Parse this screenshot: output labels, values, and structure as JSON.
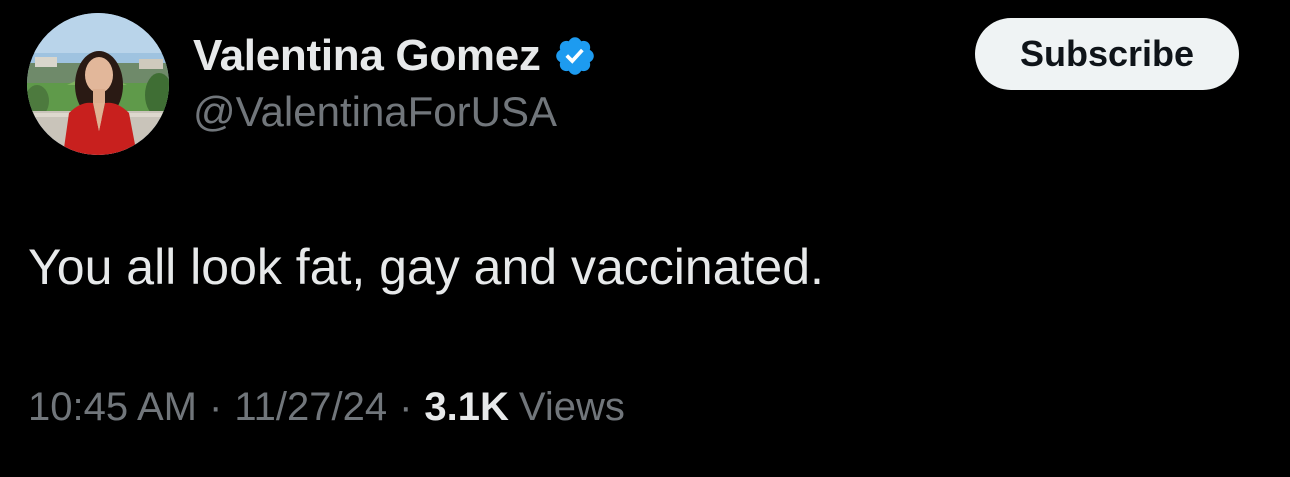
{
  "author": {
    "display_name": "Valentina Gomez",
    "handle": "@ValentinaForUSA",
    "verified_icon": "verified-badge-icon",
    "avatar_icon": "profile-photo"
  },
  "actions": {
    "subscribe_label": "Subscribe"
  },
  "tweet": {
    "text": "You all look fat, gay and vaccinated."
  },
  "meta": {
    "time": "10:45 AM",
    "separator": "·",
    "date": "11/27/24",
    "views_count": "3.1K",
    "views_label": "Views"
  },
  "colors": {
    "background": "#000000",
    "primary_text": "#e7e9ea",
    "secondary_text": "#71767b",
    "verified_blue": "#1d9bf0",
    "subscribe_bg": "#eff3f4",
    "subscribe_text": "#0f1419"
  }
}
